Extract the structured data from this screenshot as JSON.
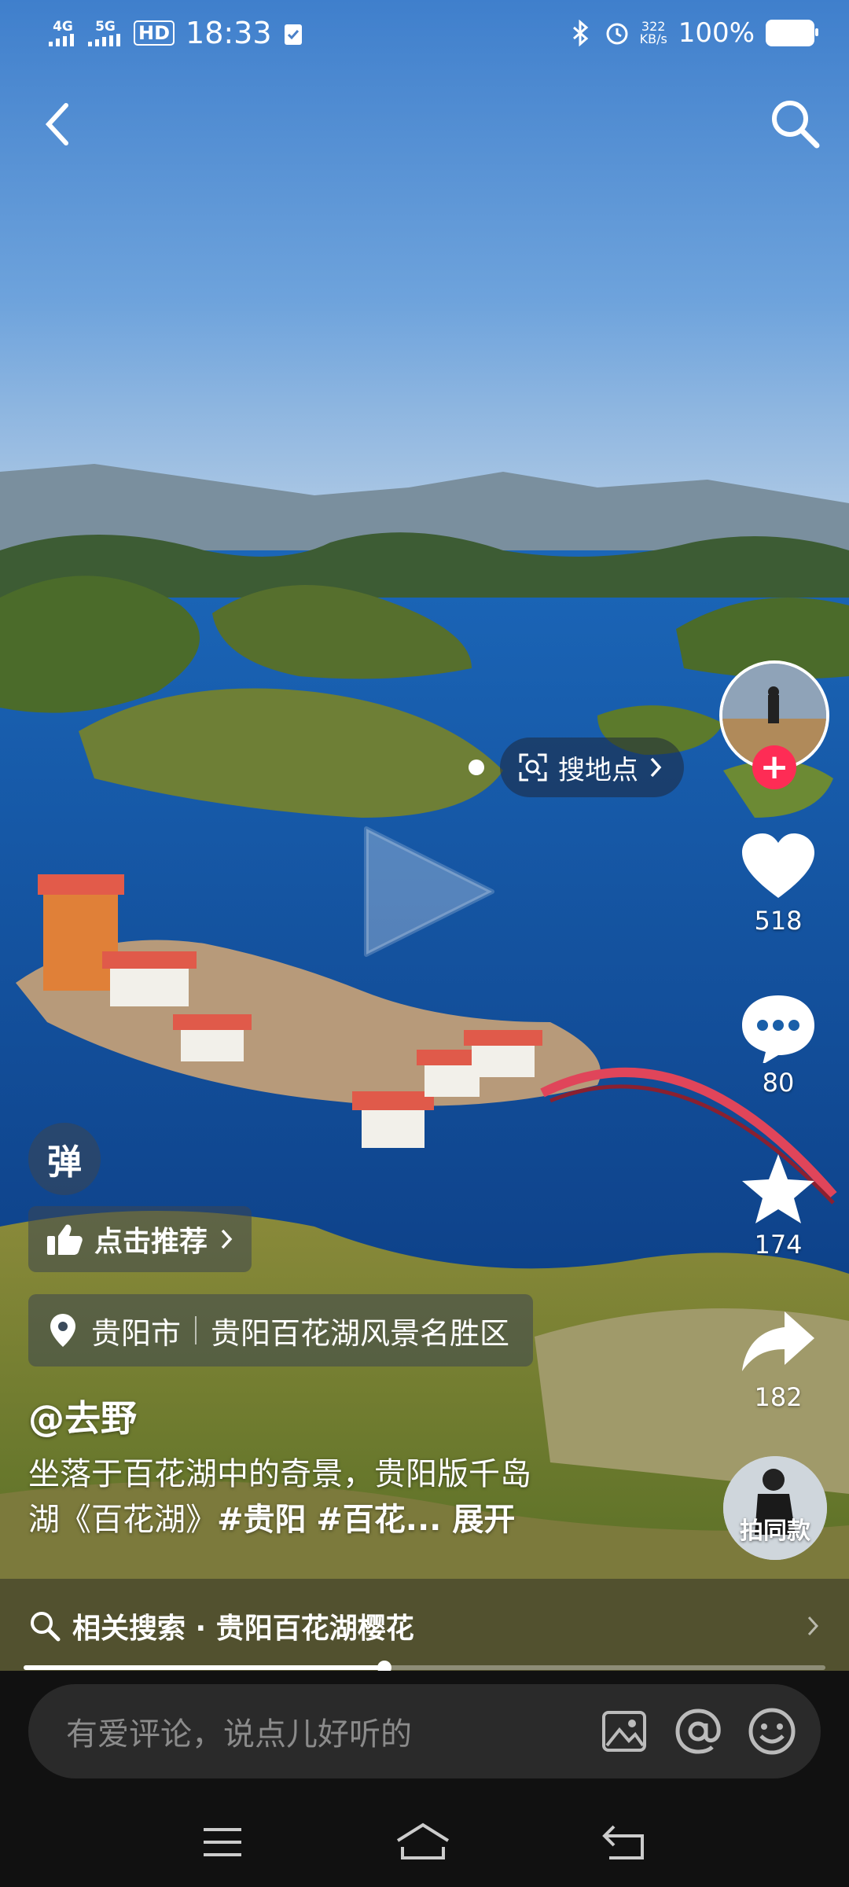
{
  "status_bar": {
    "signal_1": "4G",
    "signal_2": "5G",
    "hd": "HD",
    "time": "18:33",
    "speed_value": "322",
    "speed_unit": "KB/s",
    "battery": "100%"
  },
  "poi_chip": {
    "label": "搜地点"
  },
  "actions": {
    "like_count": "518",
    "comment_count": "80",
    "favorite_count": "174",
    "share_count": "182",
    "shoot_same_label": "拍同款"
  },
  "danmaku": {
    "label": "弹"
  },
  "recommend": {
    "label": "点击推荐"
  },
  "location": {
    "city": "贵阳市",
    "place": "贵阳百花湖风景名胜区"
  },
  "video": {
    "author": "@去野",
    "desc_line1": "坐落于百花湖中的奇景，贵阳版千岛",
    "desc_line2_text": "湖《百花湖》",
    "tag1": "#贵阳",
    "tag2": "#百花...",
    "expand": "展开",
    "progress": 0.45
  },
  "related": {
    "text": "相关搜索 · 贵阳百花湖樱花"
  },
  "comment": {
    "placeholder": "有爱评论，说点儿好听的"
  },
  "colors": {
    "accent": "#fe2c55",
    "water": "#1a5fa8",
    "sky": "#4a88d0"
  }
}
